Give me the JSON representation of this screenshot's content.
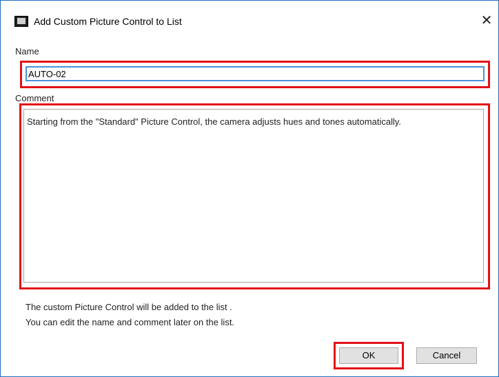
{
  "window": {
    "title": "Add Custom Picture Control to List",
    "app_icon": "picture-control-icon",
    "close_glyph": "✕"
  },
  "name_field": {
    "label": "Name",
    "value": "AUTO-02"
  },
  "comment_field": {
    "label": "Comment",
    "value": "Starting from the \"Standard\" Picture Control, the camera adjusts hues and tones automatically."
  },
  "info": {
    "line1": "The custom Picture Control will be added to the list .",
    "line2": "You can edit the name and comment later on the list."
  },
  "buttons": {
    "ok": "OK",
    "cancel": "Cancel"
  },
  "colors": {
    "highlight": "#e31018",
    "focus_border": "#4a90d9",
    "window_border": "#1e6fbf"
  }
}
